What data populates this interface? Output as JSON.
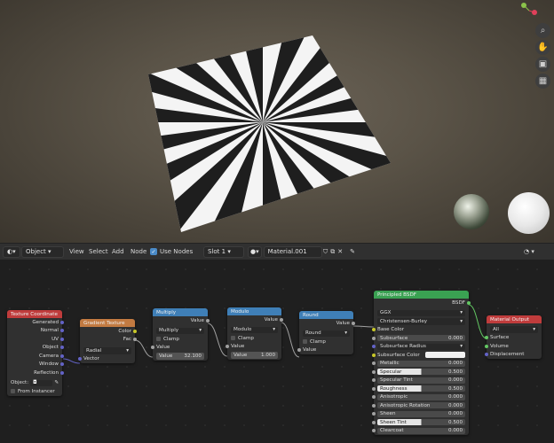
{
  "colors": {
    "frame": "#c03c3c",
    "texture": "#c27a41",
    "converter": "#3f7fb7",
    "shader": "#3aa152",
    "output": "#c03c3c"
  },
  "header": {
    "mode": "Object",
    "menu": [
      "View",
      "Select",
      "Add",
      "Node"
    ],
    "use_nodes": "Use Nodes",
    "slot": "Slot 1",
    "material": "Material.001"
  },
  "nodes": {
    "texcoord": {
      "title": "Texture Coordinate",
      "outputs": [
        "Generated",
        "Normal",
        "UV",
        "Object",
        "Camera",
        "Window",
        "Reflection"
      ],
      "object_label": "Object:",
      "from_instancer": "From Instancer"
    },
    "gradient": {
      "title": "Gradient Texture",
      "outputs": [
        "Color",
        "Fac"
      ],
      "type": "Radial",
      "input": "Vector"
    },
    "multiply": {
      "title": "Multiply",
      "output": "Value",
      "op": "Multiply",
      "clamp": "Clamp",
      "in_label": "Value",
      "field_label": "Value",
      "field_value": "32.100"
    },
    "modulo": {
      "title": "Modulo",
      "output": "Value",
      "op": "Modulo",
      "clamp": "Clamp",
      "in_label": "Value",
      "field_label": "Value",
      "field_value": "1.000"
    },
    "round": {
      "title": "Round",
      "output": "Value",
      "op": "Round",
      "clamp": "Clamp",
      "in_label": "Value"
    },
    "bsdf": {
      "title": "Principled BSDF",
      "output": "BSDF",
      "distribution": "GGX",
      "subsurface_method": "Christensen-Burley",
      "rows": [
        {
          "label": "Base Color",
          "kind": "text"
        },
        {
          "label": "Subsurface",
          "value": "0.000",
          "kind": "bar",
          "fill": 0
        },
        {
          "label": "Subsurface Radius",
          "kind": "select"
        },
        {
          "label": "Subsurface Color",
          "kind": "color"
        },
        {
          "label": "Metallic",
          "value": "0.000",
          "kind": "bar",
          "fill": 0
        },
        {
          "label": "Specular",
          "value": "0.500",
          "kind": "bar",
          "fill": 0.5
        },
        {
          "label": "Specular Tint",
          "value": "0.000",
          "kind": "bar",
          "fill": 0
        },
        {
          "label": "Roughness",
          "value": "0.500",
          "kind": "bar",
          "fill": 0.5
        },
        {
          "label": "Anisotropic",
          "value": "0.000",
          "kind": "bar",
          "fill": 0
        },
        {
          "label": "Anisotropic Rotation",
          "value": "0.000",
          "kind": "bar",
          "fill": 0
        },
        {
          "label": "Sheen",
          "value": "0.000",
          "kind": "bar",
          "fill": 0
        },
        {
          "label": "Sheen Tint",
          "value": "0.500",
          "kind": "bar",
          "fill": 0.5
        },
        {
          "label": "Clearcoat",
          "value": "0.000",
          "kind": "bar",
          "fill": 0
        }
      ]
    },
    "output": {
      "title": "Material Output",
      "target": "All",
      "inputs": [
        "Surface",
        "Volume",
        "Displacement"
      ]
    }
  }
}
